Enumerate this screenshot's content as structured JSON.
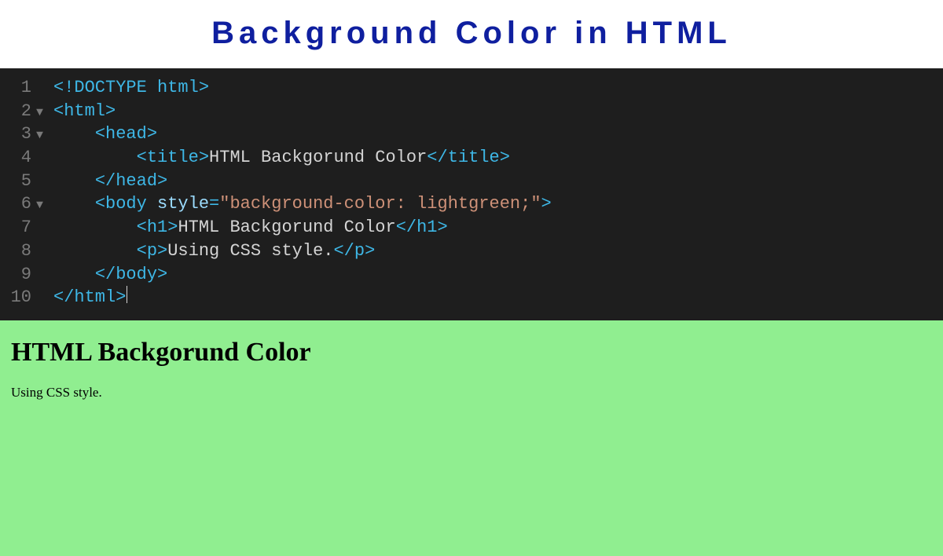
{
  "header": {
    "title": "Background Color in HTML"
  },
  "editor": {
    "lines": [
      {
        "num": "1",
        "fold": "",
        "indent": "",
        "tokens": [
          {
            "cls": "tag",
            "t": "<!DOCTYPE html>"
          }
        ]
      },
      {
        "num": "2",
        "fold": "▼",
        "indent": "",
        "tokens": [
          {
            "cls": "tag",
            "t": "<html>"
          }
        ]
      },
      {
        "num": "3",
        "fold": "▼",
        "indent": "    ",
        "tokens": [
          {
            "cls": "tag",
            "t": "<head>"
          }
        ]
      },
      {
        "num": "4",
        "fold": "",
        "indent": "        ",
        "tokens": [
          {
            "cls": "tag",
            "t": "<title>"
          },
          {
            "cls": "text",
            "t": "HTML Backgorund Color"
          },
          {
            "cls": "tag",
            "t": "</title>"
          }
        ]
      },
      {
        "num": "5",
        "fold": "",
        "indent": "    ",
        "tokens": [
          {
            "cls": "tag",
            "t": "</head>"
          }
        ]
      },
      {
        "num": "6",
        "fold": "▼",
        "indent": "    ",
        "tokens": [
          {
            "cls": "tag",
            "t": "<body "
          },
          {
            "cls": "attr",
            "t": "style"
          },
          {
            "cls": "tag",
            "t": "="
          },
          {
            "cls": "str",
            "t": "\"background-color: lightgreen;\""
          },
          {
            "cls": "tag",
            "t": ">"
          }
        ]
      },
      {
        "num": "7",
        "fold": "",
        "indent": "        ",
        "tokens": [
          {
            "cls": "tag",
            "t": "<h1>"
          },
          {
            "cls": "text",
            "t": "HTML Backgorund Color"
          },
          {
            "cls": "tag",
            "t": "</h1>"
          }
        ]
      },
      {
        "num": "8",
        "fold": "",
        "indent": "        ",
        "tokens": [
          {
            "cls": "tag",
            "t": "<p>"
          },
          {
            "cls": "text",
            "t": "Using CSS style."
          },
          {
            "cls": "tag",
            "t": "</p>"
          }
        ]
      },
      {
        "num": "9",
        "fold": "",
        "indent": "    ",
        "tokens": [
          {
            "cls": "tag",
            "t": "</body>"
          }
        ]
      },
      {
        "num": "10",
        "fold": "",
        "indent": "",
        "tokens": [
          {
            "cls": "tag",
            "t": "</html>"
          }
        ],
        "cursor": true
      }
    ]
  },
  "preview": {
    "heading": "HTML Backgorund Color",
    "paragraph": "Using CSS style."
  }
}
